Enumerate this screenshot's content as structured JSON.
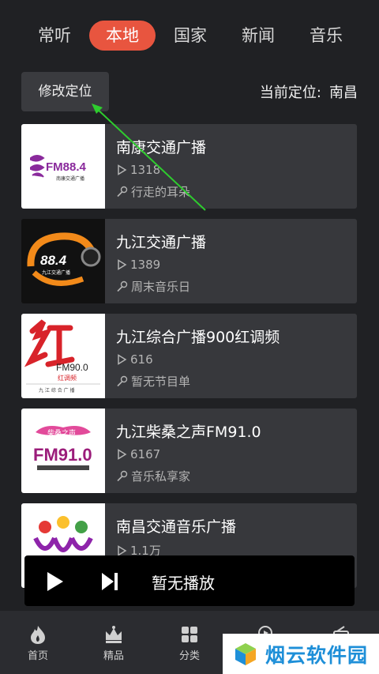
{
  "tabs": [
    {
      "label": "常听"
    },
    {
      "label": "本地"
    },
    {
      "label": "国家"
    },
    {
      "label": "新闻"
    },
    {
      "label": "音乐"
    }
  ],
  "location": {
    "edit_button": "修改定位",
    "current_label": "当前定位:",
    "current_city": "南昌"
  },
  "stations": [
    {
      "title": "南康交通广播",
      "plays": "1318",
      "host": "行走的耳朵",
      "cover_text": "FM88.4",
      "cover_sub": "南康交通广播"
    },
    {
      "title": "九江交通广播",
      "plays": "1389",
      "host": "周末音乐日",
      "cover_text": "88.4",
      "cover_sub": "九江交通广播"
    },
    {
      "title": "九江综合广播900红调频",
      "plays": "616",
      "host": "暂无节目单",
      "cover_text": "FM90.0",
      "cover_sub": "红调频",
      "cover_foot": "九 江 综 合 广 播"
    },
    {
      "title": "九江柴桑之声FM91.0",
      "plays": "6167",
      "host": "音乐私享家",
      "cover_text": "FM91.0",
      "cover_sub": "柴桑之声"
    },
    {
      "title": "南昌交通音乐广播",
      "plays": "1.1万",
      "host": ""
    }
  ],
  "player": {
    "status": "暂无播放"
  },
  "bottom_nav": [
    {
      "label": "首页",
      "icon": "flame-icon"
    },
    {
      "label": "精品",
      "icon": "crown-icon"
    },
    {
      "label": "分类",
      "icon": "grid-icon"
    },
    {
      "label": "",
      "icon": "music-icon"
    },
    {
      "label": "",
      "icon": "radio-icon"
    }
  ],
  "watermark": {
    "text": "烟云软件园"
  },
  "colors": {
    "accent": "#e8553f",
    "background": "#202124",
    "card": "#37383c",
    "arrow": "#2ecc2e"
  }
}
